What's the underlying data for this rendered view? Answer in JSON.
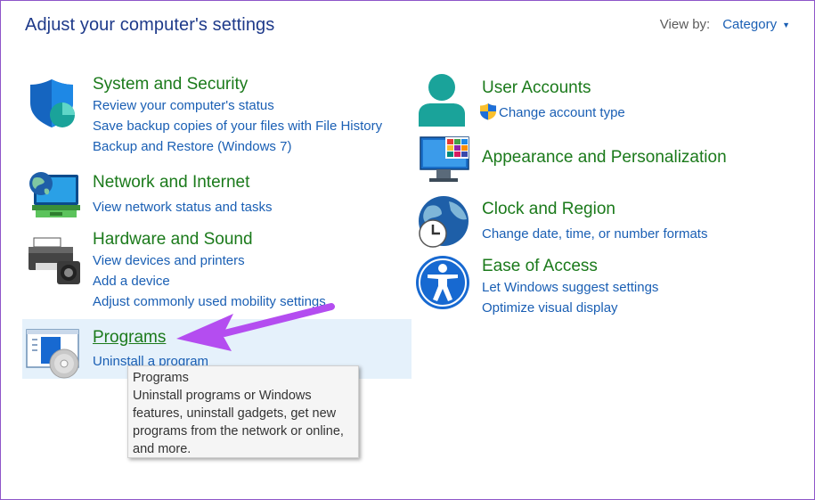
{
  "header": {
    "title": "Adjust your computer's settings",
    "view_by_label": "View by:",
    "view_by_value": "Category"
  },
  "categories": [
    {
      "title": "System and Security",
      "links": [
        "Review your computer's status",
        "Save backup copies of your files with File History",
        "Backup and Restore (Windows 7)"
      ]
    },
    {
      "title": "Network and Internet",
      "links": [
        "View network status and tasks"
      ]
    },
    {
      "title": "Hardware and Sound",
      "links": [
        "View devices and printers",
        "Add a device",
        "Adjust commonly used mobility settings"
      ]
    },
    {
      "title": "Programs",
      "links": [
        "Uninstall a program"
      ]
    },
    {
      "title": "User Accounts",
      "links": [
        "Change account type"
      ]
    },
    {
      "title": "Appearance and Personalization",
      "links": []
    },
    {
      "title": "Clock and Region",
      "links": [
        "Change date, time, or number formats"
      ]
    },
    {
      "title": "Ease of Access",
      "links": [
        "Let Windows suggest settings",
        "Optimize visual display"
      ]
    }
  ],
  "tooltip": {
    "title": "Programs",
    "body": "Uninstall programs or Windows features, uninstall gadgets, get new programs from the network or online, and more."
  },
  "colors": {
    "category_title": "#1b7a1b",
    "link": "#1a5fb4",
    "header": "#1e3a8a",
    "highlight": "#e5f1fb",
    "annotation_arrow": "#b44df0"
  }
}
